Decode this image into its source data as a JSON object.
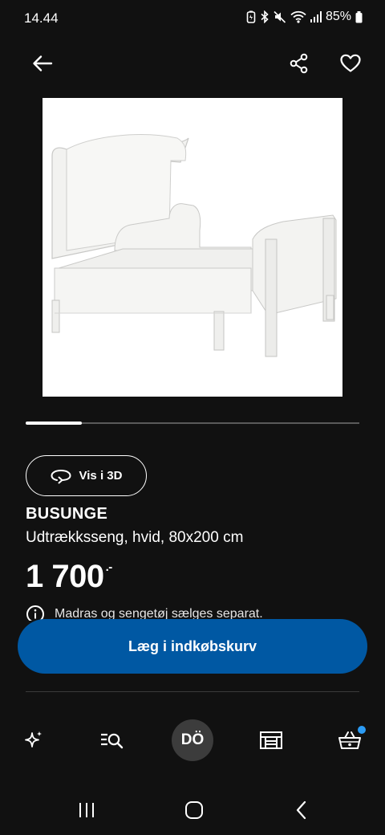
{
  "status_bar": {
    "time": "14.44",
    "battery": "85%"
  },
  "top_bar": {
    "back_icon": "arrow-left-icon",
    "share_icon": "share-icon",
    "favorite_icon": "heart-icon"
  },
  "gallery": {
    "image_alt": "Udtrækkeseng, hvid",
    "current_index_fraction": 0.17
  },
  "view_3d": {
    "label": "Vis i 3D",
    "icon": "rotate-3d-icon"
  },
  "product": {
    "name": "BUSUNGE",
    "description": "Udtrækksseng, hvid, 80x200 cm",
    "price": "1 700",
    "price_suffix": ".-",
    "info_text": "Madras og sengetøj sælges separat."
  },
  "cart_button": {
    "label": "Læg i indkøbskurv"
  },
  "bottom_nav": {
    "items": [
      {
        "name": "sparkle-icon"
      },
      {
        "name": "search-list-icon"
      },
      {
        "avatar_initials": "DÖ"
      },
      {
        "name": "store-icon"
      },
      {
        "name": "basket-icon"
      }
    ]
  },
  "colors": {
    "background": "#111111",
    "accent": "#0058a3",
    "badge": "#2b9bf4"
  }
}
